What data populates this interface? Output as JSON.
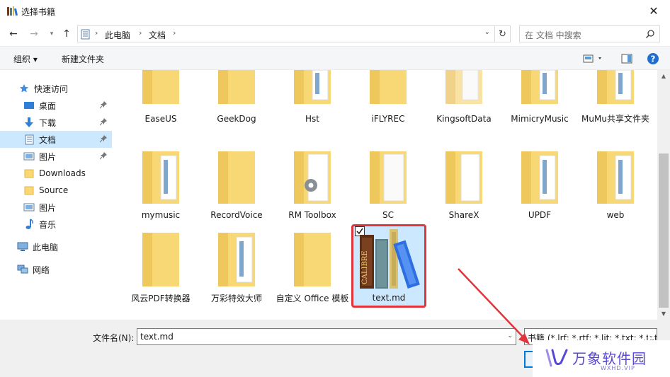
{
  "window": {
    "title": "选择书籍"
  },
  "nav": {
    "breadcrumbs": [
      "此电脑",
      "文档"
    ],
    "search_placeholder": "在 文档 中搜索"
  },
  "toolbar": {
    "organize_label": "组织 ▾",
    "new_folder_label": "新建文件夹"
  },
  "sidebar": {
    "quick_access": "快速访问",
    "items": [
      {
        "label": "桌面",
        "icon": "desktop-icon"
      },
      {
        "label": "下载",
        "icon": "download-icon"
      },
      {
        "label": "文档",
        "icon": "documents-icon"
      },
      {
        "label": "图片",
        "icon": "pictures-icon"
      },
      {
        "label": "Downloads",
        "icon": "folder-icon"
      },
      {
        "label": "Source",
        "icon": "folder-icon"
      },
      {
        "label": "图片",
        "icon": "pictures-icon"
      },
      {
        "label": "音乐",
        "icon": "music-icon"
      }
    ],
    "this_pc": "此电脑",
    "network": "网络"
  },
  "files": [
    {
      "label": "EaseUS"
    },
    {
      "label": "GeekDog"
    },
    {
      "label": "Hst"
    },
    {
      "label": "iFLYREC"
    },
    {
      "label": "KingsoftData"
    },
    {
      "label": "MimicryMusic"
    },
    {
      "label": "MuMu共享文件夹"
    },
    {
      "label": "mymusic"
    },
    {
      "label": "RecordVoice"
    },
    {
      "label": "RM Toolbox"
    },
    {
      "label": "SC"
    },
    {
      "label": "ShareX"
    },
    {
      "label": "UPDF"
    },
    {
      "label": "web"
    },
    {
      "label": "风云PDF转换器"
    },
    {
      "label": "万彩特效大师"
    },
    {
      "label": "自定义 Office 模板"
    },
    {
      "label": "text.md"
    }
  ],
  "selected_file_logo_text": "CALIBRE",
  "bottom": {
    "filename_label": "文件名(N):",
    "filename_value": "text.md",
    "filter_value": "书籍 (*.lrf; *.rtf; *.lit; *.txt; *.txt"
  },
  "watermark": {
    "text": "万象软件园",
    "sub": "WXHD.VIP"
  },
  "colors": {
    "selection": "#cce8ff",
    "highlight_border": "#e0353b",
    "arrow": "#e0353b",
    "folder": "#f8d775"
  }
}
